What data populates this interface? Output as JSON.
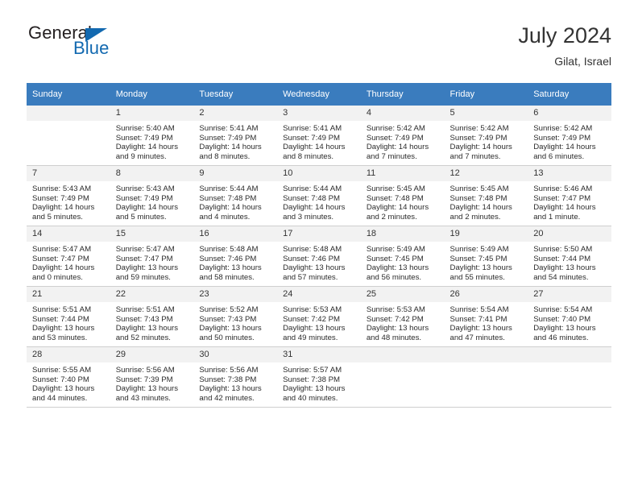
{
  "brand": {
    "word_one": "General",
    "word_two": "Blue",
    "triangle_color": "#1269b0"
  },
  "header": {
    "title": "July 2024",
    "location": "Gilat, Israel"
  },
  "theme": {
    "header_row_bg": "#3a7cbe",
    "daynum_bg": "#f2f2f2",
    "grid_line": "#cfcfcf",
    "text": "#2b2b2b"
  },
  "weekday_headers": [
    "Sunday",
    "Monday",
    "Tuesday",
    "Wednesday",
    "Thursday",
    "Friday",
    "Saturday"
  ],
  "weeks": [
    [
      {
        "day": "",
        "sunrise": "",
        "sunset": "",
        "daylight_1": "",
        "daylight_2": "",
        "empty": true
      },
      {
        "day": "1",
        "sunrise": "Sunrise: 5:40 AM",
        "sunset": "Sunset: 7:49 PM",
        "daylight_1": "Daylight: 14 hours",
        "daylight_2": "and 9 minutes.",
        "empty": false
      },
      {
        "day": "2",
        "sunrise": "Sunrise: 5:41 AM",
        "sunset": "Sunset: 7:49 PM",
        "daylight_1": "Daylight: 14 hours",
        "daylight_2": "and 8 minutes.",
        "empty": false
      },
      {
        "day": "3",
        "sunrise": "Sunrise: 5:41 AM",
        "sunset": "Sunset: 7:49 PM",
        "daylight_1": "Daylight: 14 hours",
        "daylight_2": "and 8 minutes.",
        "empty": false
      },
      {
        "day": "4",
        "sunrise": "Sunrise: 5:42 AM",
        "sunset": "Sunset: 7:49 PM",
        "daylight_1": "Daylight: 14 hours",
        "daylight_2": "and 7 minutes.",
        "empty": false
      },
      {
        "day": "5",
        "sunrise": "Sunrise: 5:42 AM",
        "sunset": "Sunset: 7:49 PM",
        "daylight_1": "Daylight: 14 hours",
        "daylight_2": "and 7 minutes.",
        "empty": false
      },
      {
        "day": "6",
        "sunrise": "Sunrise: 5:42 AM",
        "sunset": "Sunset: 7:49 PM",
        "daylight_1": "Daylight: 14 hours",
        "daylight_2": "and 6 minutes.",
        "empty": false
      }
    ],
    [
      {
        "day": "7",
        "sunrise": "Sunrise: 5:43 AM",
        "sunset": "Sunset: 7:49 PM",
        "daylight_1": "Daylight: 14 hours",
        "daylight_2": "and 5 minutes.",
        "empty": false
      },
      {
        "day": "8",
        "sunrise": "Sunrise: 5:43 AM",
        "sunset": "Sunset: 7:49 PM",
        "daylight_1": "Daylight: 14 hours",
        "daylight_2": "and 5 minutes.",
        "empty": false
      },
      {
        "day": "9",
        "sunrise": "Sunrise: 5:44 AM",
        "sunset": "Sunset: 7:48 PM",
        "daylight_1": "Daylight: 14 hours",
        "daylight_2": "and 4 minutes.",
        "empty": false
      },
      {
        "day": "10",
        "sunrise": "Sunrise: 5:44 AM",
        "sunset": "Sunset: 7:48 PM",
        "daylight_1": "Daylight: 14 hours",
        "daylight_2": "and 3 minutes.",
        "empty": false
      },
      {
        "day": "11",
        "sunrise": "Sunrise: 5:45 AM",
        "sunset": "Sunset: 7:48 PM",
        "daylight_1": "Daylight: 14 hours",
        "daylight_2": "and 2 minutes.",
        "empty": false
      },
      {
        "day": "12",
        "sunrise": "Sunrise: 5:45 AM",
        "sunset": "Sunset: 7:48 PM",
        "daylight_1": "Daylight: 14 hours",
        "daylight_2": "and 2 minutes.",
        "empty": false
      },
      {
        "day": "13",
        "sunrise": "Sunrise: 5:46 AM",
        "sunset": "Sunset: 7:47 PM",
        "daylight_1": "Daylight: 14 hours",
        "daylight_2": "and 1 minute.",
        "empty": false
      }
    ],
    [
      {
        "day": "14",
        "sunrise": "Sunrise: 5:47 AM",
        "sunset": "Sunset: 7:47 PM",
        "daylight_1": "Daylight: 14 hours",
        "daylight_2": "and 0 minutes.",
        "empty": false
      },
      {
        "day": "15",
        "sunrise": "Sunrise: 5:47 AM",
        "sunset": "Sunset: 7:47 PM",
        "daylight_1": "Daylight: 13 hours",
        "daylight_2": "and 59 minutes.",
        "empty": false
      },
      {
        "day": "16",
        "sunrise": "Sunrise: 5:48 AM",
        "sunset": "Sunset: 7:46 PM",
        "daylight_1": "Daylight: 13 hours",
        "daylight_2": "and 58 minutes.",
        "empty": false
      },
      {
        "day": "17",
        "sunrise": "Sunrise: 5:48 AM",
        "sunset": "Sunset: 7:46 PM",
        "daylight_1": "Daylight: 13 hours",
        "daylight_2": "and 57 minutes.",
        "empty": false
      },
      {
        "day": "18",
        "sunrise": "Sunrise: 5:49 AM",
        "sunset": "Sunset: 7:45 PM",
        "daylight_1": "Daylight: 13 hours",
        "daylight_2": "and 56 minutes.",
        "empty": false
      },
      {
        "day": "19",
        "sunrise": "Sunrise: 5:49 AM",
        "sunset": "Sunset: 7:45 PM",
        "daylight_1": "Daylight: 13 hours",
        "daylight_2": "and 55 minutes.",
        "empty": false
      },
      {
        "day": "20",
        "sunrise": "Sunrise: 5:50 AM",
        "sunset": "Sunset: 7:44 PM",
        "daylight_1": "Daylight: 13 hours",
        "daylight_2": "and 54 minutes.",
        "empty": false
      }
    ],
    [
      {
        "day": "21",
        "sunrise": "Sunrise: 5:51 AM",
        "sunset": "Sunset: 7:44 PM",
        "daylight_1": "Daylight: 13 hours",
        "daylight_2": "and 53 minutes.",
        "empty": false
      },
      {
        "day": "22",
        "sunrise": "Sunrise: 5:51 AM",
        "sunset": "Sunset: 7:43 PM",
        "daylight_1": "Daylight: 13 hours",
        "daylight_2": "and 52 minutes.",
        "empty": false
      },
      {
        "day": "23",
        "sunrise": "Sunrise: 5:52 AM",
        "sunset": "Sunset: 7:43 PM",
        "daylight_1": "Daylight: 13 hours",
        "daylight_2": "and 50 minutes.",
        "empty": false
      },
      {
        "day": "24",
        "sunrise": "Sunrise: 5:53 AM",
        "sunset": "Sunset: 7:42 PM",
        "daylight_1": "Daylight: 13 hours",
        "daylight_2": "and 49 minutes.",
        "empty": false
      },
      {
        "day": "25",
        "sunrise": "Sunrise: 5:53 AM",
        "sunset": "Sunset: 7:42 PM",
        "daylight_1": "Daylight: 13 hours",
        "daylight_2": "and 48 minutes.",
        "empty": false
      },
      {
        "day": "26",
        "sunrise": "Sunrise: 5:54 AM",
        "sunset": "Sunset: 7:41 PM",
        "daylight_1": "Daylight: 13 hours",
        "daylight_2": "and 47 minutes.",
        "empty": false
      },
      {
        "day": "27",
        "sunrise": "Sunrise: 5:54 AM",
        "sunset": "Sunset: 7:40 PM",
        "daylight_1": "Daylight: 13 hours",
        "daylight_2": "and 46 minutes.",
        "empty": false
      }
    ],
    [
      {
        "day": "28",
        "sunrise": "Sunrise: 5:55 AM",
        "sunset": "Sunset: 7:40 PM",
        "daylight_1": "Daylight: 13 hours",
        "daylight_2": "and 44 minutes.",
        "empty": false
      },
      {
        "day": "29",
        "sunrise": "Sunrise: 5:56 AM",
        "sunset": "Sunset: 7:39 PM",
        "daylight_1": "Daylight: 13 hours",
        "daylight_2": "and 43 minutes.",
        "empty": false
      },
      {
        "day": "30",
        "sunrise": "Sunrise: 5:56 AM",
        "sunset": "Sunset: 7:38 PM",
        "daylight_1": "Daylight: 13 hours",
        "daylight_2": "and 42 minutes.",
        "empty": false
      },
      {
        "day": "31",
        "sunrise": "Sunrise: 5:57 AM",
        "sunset": "Sunset: 7:38 PM",
        "daylight_1": "Daylight: 13 hours",
        "daylight_2": "and 40 minutes.",
        "empty": false
      },
      {
        "day": "",
        "sunrise": "",
        "sunset": "",
        "daylight_1": "",
        "daylight_2": "",
        "empty": true
      },
      {
        "day": "",
        "sunrise": "",
        "sunset": "",
        "daylight_1": "",
        "daylight_2": "",
        "empty": true
      },
      {
        "day": "",
        "sunrise": "",
        "sunset": "",
        "daylight_1": "",
        "daylight_2": "",
        "empty": true
      }
    ]
  ]
}
